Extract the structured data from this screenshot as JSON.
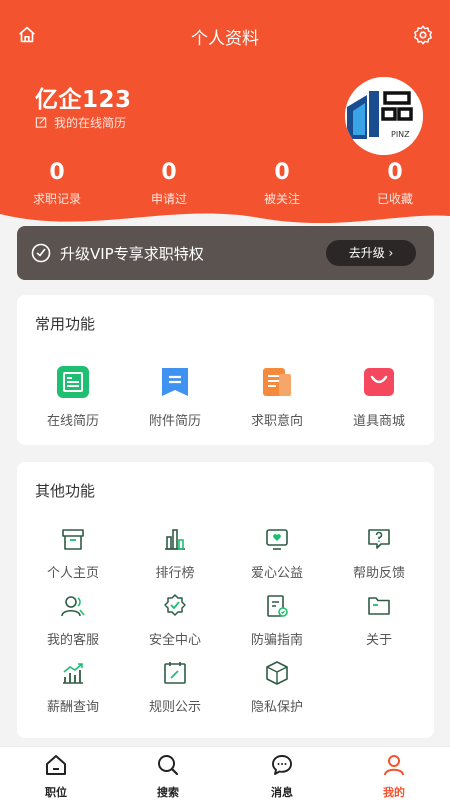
{
  "header": {
    "title": "个人资料"
  },
  "profile": {
    "name": "亿企123",
    "resume_link": "我的在线简历",
    "avatar_text": "PINZ"
  },
  "stats": [
    {
      "value": "0",
      "label": "求职记录"
    },
    {
      "value": "0",
      "label": "申请过"
    },
    {
      "value": "0",
      "label": "被关注"
    },
    {
      "value": "0",
      "label": "已收藏"
    }
  ],
  "vip": {
    "text": "升级VIP专享求职特权",
    "button": "去升级 ›"
  },
  "common": {
    "title": "常用功能",
    "items": [
      {
        "label": "在线简历",
        "icon": "online-resume-icon"
      },
      {
        "label": "附件简历",
        "icon": "attachment-resume-icon"
      },
      {
        "label": "求职意向",
        "icon": "job-intention-icon"
      },
      {
        "label": "道具商城",
        "icon": "shop-bag-icon"
      }
    ]
  },
  "other": {
    "title": "其他功能",
    "items": [
      {
        "label": "个人主页",
        "icon": "homepage-icon"
      },
      {
        "label": "排行榜",
        "icon": "ranking-icon"
      },
      {
        "label": "爱心公益",
        "icon": "charity-icon"
      },
      {
        "label": "帮助反馈",
        "icon": "help-icon"
      },
      {
        "label": "我的客服",
        "icon": "customer-service-icon"
      },
      {
        "label": "安全中心",
        "icon": "security-icon"
      },
      {
        "label": "防骗指南",
        "icon": "anti-fraud-icon"
      },
      {
        "label": "关于",
        "icon": "about-icon"
      },
      {
        "label": "薪酬查询",
        "icon": "salary-icon"
      },
      {
        "label": "规则公示",
        "icon": "rules-icon"
      },
      {
        "label": "隐私保护",
        "icon": "privacy-icon"
      }
    ]
  },
  "tabs": [
    {
      "label": "职位",
      "icon": "home-icon"
    },
    {
      "label": "搜索",
      "icon": "search-icon"
    },
    {
      "label": "消息",
      "icon": "message-icon"
    },
    {
      "label": "我的",
      "icon": "user-icon",
      "active": true
    }
  ],
  "colors": {
    "accent": "#f4532f",
    "vip_bg": "#5a5350",
    "green": "#1fbf72",
    "blue": "#3f92f2",
    "orange": "#f58a3c",
    "red": "#f5475e",
    "icon_stroke": "#2f5c45"
  }
}
